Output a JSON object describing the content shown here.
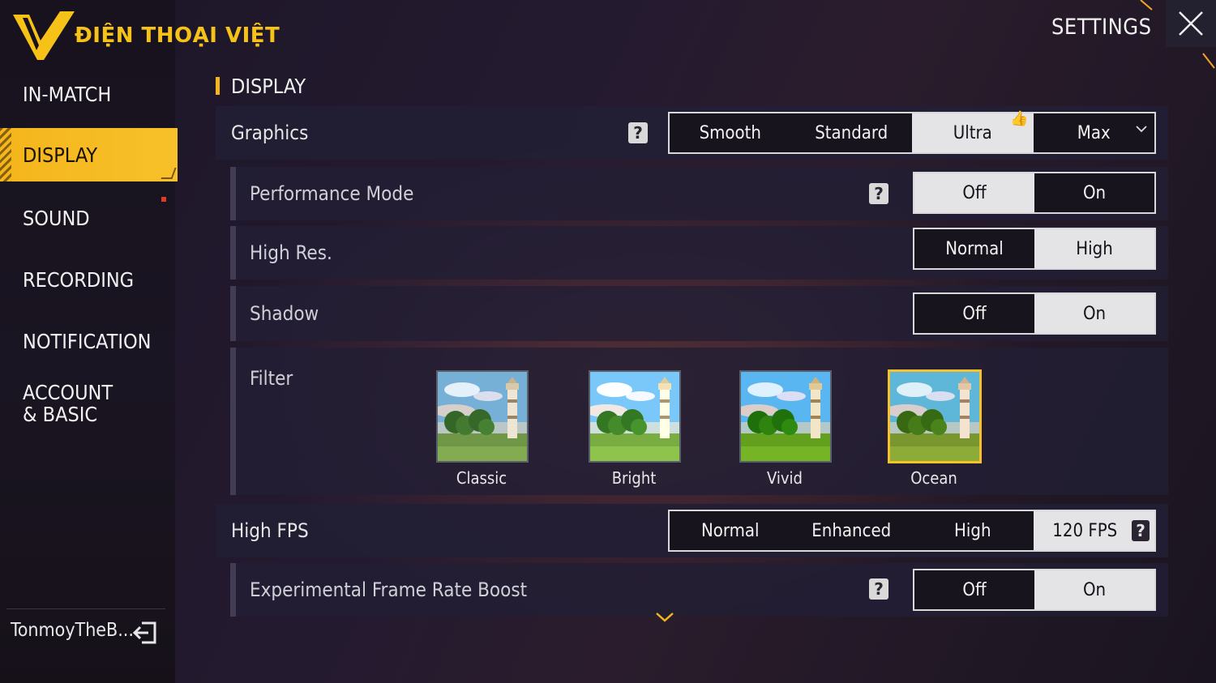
{
  "brand": {
    "logo_text": "ĐIỆN THOẠI VIỆT",
    "accent": "#f5b51c"
  },
  "header": {
    "title": "SETTINGS",
    "close_icon": "close-icon"
  },
  "sidebar": {
    "items": [
      {
        "label": "IN-MATCH"
      },
      {
        "label": "DISPLAY",
        "active": true
      },
      {
        "label": "SOUND",
        "badge": "red-dot"
      },
      {
        "label": "RECORDING"
      },
      {
        "label": "NOTIFICATION"
      },
      {
        "label": "ACCOUNT & BASIC"
      }
    ],
    "username": "TonmoyTheB...",
    "logout_icon": "logout-icon"
  },
  "section": {
    "title": "DISPLAY"
  },
  "graphics": {
    "label": "Graphics",
    "options": [
      "Smooth",
      "Standard",
      "Ultra",
      "Max"
    ],
    "selected": "Ultra"
  },
  "performance_mode": {
    "label": "Performance Mode",
    "options": [
      "Off",
      "On"
    ],
    "selected": "Off"
  },
  "high_res": {
    "label": "High Res.",
    "options": [
      "Normal",
      "High"
    ],
    "selected": "High"
  },
  "shadow": {
    "label": "Shadow",
    "options": [
      "Off",
      "On"
    ],
    "selected": "On"
  },
  "filter": {
    "label": "Filter",
    "options": [
      "Classic",
      "Bright",
      "Vivid",
      "Ocean"
    ],
    "selected": "Ocean"
  },
  "high_fps": {
    "label": "High FPS",
    "options": [
      "Normal",
      "Enhanced",
      "High",
      "120 FPS"
    ],
    "selected": "120 FPS"
  },
  "frame_boost": {
    "label": "Experimental Frame Rate Boost",
    "options": [
      "Off",
      "On"
    ],
    "selected": "On"
  }
}
